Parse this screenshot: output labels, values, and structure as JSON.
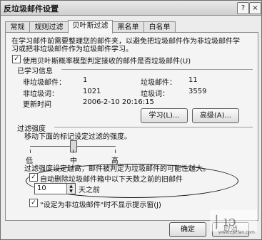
{
  "window": {
    "title": "反垃圾邮件设置"
  },
  "tabs": [
    "常规",
    "规则过滤",
    "贝叶斯过滤",
    "黑名单",
    "白名单"
  ],
  "intro": [
    "在学习邮件前需要整理您的邮件夹，以避免把垃圾邮件作为非垃圾邮件学",
    "习或把非垃圾邮件作为垃圾邮件学习。"
  ],
  "bayes": {
    "use_label": "使用贝叶斯概率模型判定接收的邮件是否垃圾邮件(U)",
    "learned_title": "已学习信息",
    "non_spam_mail_label": "非垃圾邮件：",
    "non_spam_mail_value": "1",
    "spam_mail_label": "垃圾邮件：",
    "spam_mail_value": "11",
    "non_spam_words_label": "非垃圾词：",
    "non_spam_words_value": "1021",
    "spam_words_label": "垃圾词：",
    "spam_words_value": "3559",
    "updated_label": "更新时间",
    "updated_value": "2006-2-10 20:16:15",
    "learn_button": "学习(L)...",
    "advanced_button": "高级(A)..."
  },
  "filter": {
    "section_title": "过滤强度",
    "slider_hint": "移动下面的标记设定过滤的强度。",
    "level": 0.5,
    "labels": [
      "低",
      "中",
      "高"
    ],
    "note": "过滤强度设定越高，邮件被判定为垃圾邮件的可能性越大。",
    "auto_delete_label": "自动删除垃圾邮件箱中以下天数之前的旧邮件",
    "days_value": "10",
    "days_suffix": "天之前",
    "hint_label": "\"设定为非垃圾邮件\"时不显示提示窗(J)"
  },
  "buttons": {
    "ok": "确定",
    "cancel": "取消"
  },
  "watermark": {
    "text": "www.cpcfan.com"
  }
}
